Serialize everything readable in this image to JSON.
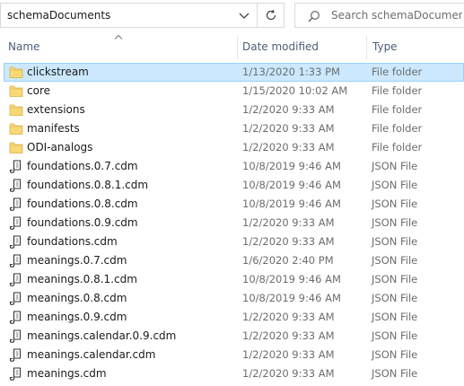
{
  "address": {
    "path": "schemaDocuments"
  },
  "search": {
    "placeholder": "Search schemaDocuments",
    "value": ""
  },
  "columns": {
    "name": "Name",
    "date_modified": "Date modified",
    "type": "Type"
  },
  "files": [
    {
      "name": "clickstream",
      "date": "1/13/2020 1:33 PM",
      "type": "File folder",
      "icon": "folder-icon",
      "selected": true
    },
    {
      "name": "core",
      "date": "1/15/2020 10:02 AM",
      "type": "File folder",
      "icon": "folder-icon"
    },
    {
      "name": "extensions",
      "date": "1/2/2020 9:33 AM",
      "type": "File folder",
      "icon": "folder-icon"
    },
    {
      "name": "manifests",
      "date": "1/2/2020 9:33 AM",
      "type": "File folder",
      "icon": "folder-icon"
    },
    {
      "name": "ODI-analogs",
      "date": "1/2/2020 9:33 AM",
      "type": "File folder",
      "icon": "folder-icon"
    },
    {
      "name": "foundations.0.7.cdm",
      "date": "10/8/2019 9:46 AM",
      "type": "JSON File",
      "icon": "json-file-icon"
    },
    {
      "name": "foundations.0.8.1.cdm",
      "date": "10/8/2019 9:46 AM",
      "type": "JSON File",
      "icon": "json-file-icon"
    },
    {
      "name": "foundations.0.8.cdm",
      "date": "10/8/2019 9:46 AM",
      "type": "JSON File",
      "icon": "json-file-icon"
    },
    {
      "name": "foundations.0.9.cdm",
      "date": "1/2/2020 9:33 AM",
      "type": "JSON File",
      "icon": "json-file-icon"
    },
    {
      "name": "foundations.cdm",
      "date": "1/2/2020 9:33 AM",
      "type": "JSON File",
      "icon": "json-file-icon"
    },
    {
      "name": "meanings.0.7.cdm",
      "date": "1/6/2020 2:40 PM",
      "type": "JSON File",
      "icon": "json-file-icon"
    },
    {
      "name": "meanings.0.8.1.cdm",
      "date": "10/8/2019 9:46 AM",
      "type": "JSON File",
      "icon": "json-file-icon"
    },
    {
      "name": "meanings.0.8.cdm",
      "date": "10/8/2019 9:46 AM",
      "type": "JSON File",
      "icon": "json-file-icon"
    },
    {
      "name": "meanings.0.9.cdm",
      "date": "1/2/2020 9:33 AM",
      "type": "JSON File",
      "icon": "json-file-icon"
    },
    {
      "name": "meanings.calendar.0.9.cdm",
      "date": "1/2/2020 9:33 AM",
      "type": "JSON File",
      "icon": "json-file-icon"
    },
    {
      "name": "meanings.calendar.cdm",
      "date": "1/2/2020 9:33 AM",
      "type": "JSON File",
      "icon": "json-file-icon"
    },
    {
      "name": "meanings.cdm",
      "date": "1/2/2020 9:33 AM",
      "type": "JSON File",
      "icon": "json-file-icon"
    }
  ],
  "colors": {
    "selected_bg": "#cce8ff",
    "selected_border": "#99d1ff",
    "folder": "#f8d775",
    "header_text": "#4c607a"
  }
}
